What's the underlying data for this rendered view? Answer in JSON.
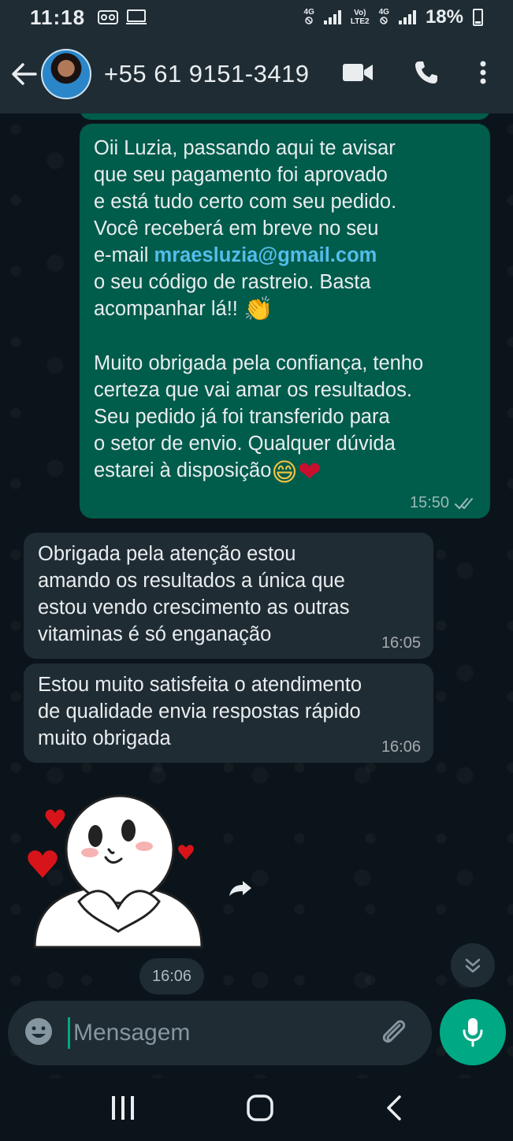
{
  "status_bar": {
    "time": "11:18",
    "net1_top": "4G",
    "net2_top": "Vo)",
    "net2_bottom": "LTE2",
    "net3_top": "4G",
    "battery": "18%"
  },
  "header": {
    "contact_name": "+55 61 9151-3419"
  },
  "messages": {
    "outgoing": {
      "text_part1": "Oii Luzia, passando aqui te avisar\nque seu pagamento foi aprovado\ne está tudo certo com seu pedido.\nVocê receberá em breve no seu\ne-mail ",
      "email": "mraesluzia@gmail.com",
      "text_part2": "\no seu código de rastreio. Basta\nacompanhar lá!! ",
      "text_part3": "Muito obrigada pela confiança, tenho\ncerteza que vai amar os resultados.\nSeu pedido já foi transferido para\no setor de envio. Qualquer dúvida\nestarei à disposição",
      "time": "15:50",
      "emoji_clap": "👏",
      "emoji_grin": "😄",
      "emoji_heart": "❤"
    },
    "incoming1": {
      "text": "Obrigada pela atenção estou\namando os resultados a única que\nestou vendo crescimento as outras\nvitaminas é só enganação",
      "time": "16:05"
    },
    "incoming2": {
      "text": "Estou muito satisfeita o atendimento\nde qualidade envia respostas rápido\nmuito obrigada",
      "time": "16:06"
    },
    "sticker": {
      "time": "16:06"
    }
  },
  "composer": {
    "placeholder": "Mensagem"
  },
  "colors": {
    "outgoing_bubble": "#005c4b",
    "incoming_bubble": "#202c33",
    "accent": "#00a884",
    "link": "#53bdeb"
  }
}
